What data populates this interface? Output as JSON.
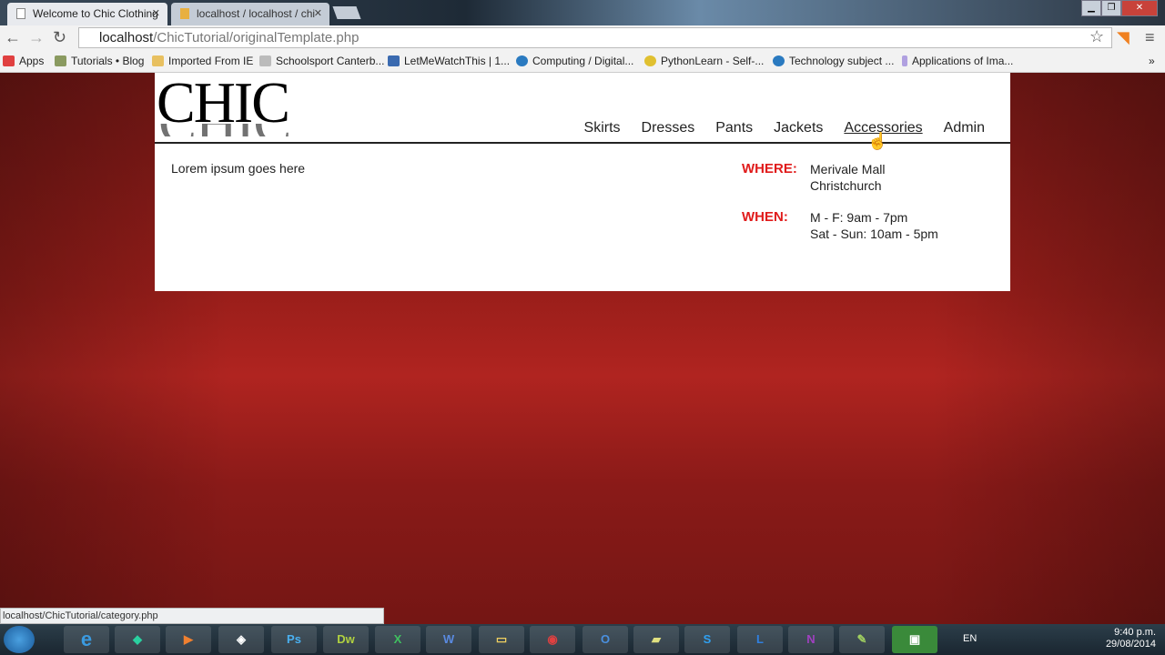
{
  "browser": {
    "tabs": [
      {
        "title": "Welcome to Chic Clothing",
        "active": true
      },
      {
        "title": "localhost / localhost / chi",
        "active": false
      }
    ],
    "url_host": "localhost",
    "url_path": "/ChicTutorial/originalTemplate.php",
    "bookmarks": [
      {
        "label": "Apps",
        "color": "#e04040"
      },
      {
        "label": "Tutorials • Blog",
        "color": "#8a9a60"
      },
      {
        "label": "Imported From IE",
        "color": "#e8c060"
      },
      {
        "label": "Schoolsport Canterb...",
        "color": "#bbbbbb"
      },
      {
        "label": "LetMeWatchThis | 1...",
        "color": "#3a6ab0"
      },
      {
        "label": "Computing / Digital...",
        "color": "#2a7ac0"
      },
      {
        "label": "PythonLearn - Self-...",
        "color": "#e0c030"
      },
      {
        "label": "Technology subject ...",
        "color": "#2a7ac0"
      },
      {
        "label": "Applications of Ima...",
        "color": "#b0a0e0"
      }
    ],
    "status_url": "localhost/ChicTutorial/category.php"
  },
  "site": {
    "logo": "CHIC",
    "nav": [
      "Skirts",
      "Dresses",
      "Pants",
      "Jackets",
      "Accessories",
      "Admin"
    ],
    "hovered": "Accessories",
    "body_text": "Lorem ipsum goes here",
    "where_label": "WHERE:",
    "where": [
      "Merivale Mall",
      "Christchurch"
    ],
    "when_label": "WHEN:",
    "when": [
      "M - F: 9am - 7pm",
      "Sat - Sun: 10am - 5pm"
    ],
    "accent": "#e01b1b"
  },
  "taskbar": {
    "apps": [
      "IE",
      "Ethereum",
      "Media",
      "Unity",
      "Ps",
      "Dw",
      "Excel",
      "Word",
      "Explorer",
      "Chrome",
      "Outlook",
      "Notes",
      "Skype",
      "Lync",
      "OneNote",
      "Editor",
      "Camtasia"
    ],
    "lang": "EN",
    "time": "9:40 p.m.",
    "date": "29/08/2014"
  }
}
